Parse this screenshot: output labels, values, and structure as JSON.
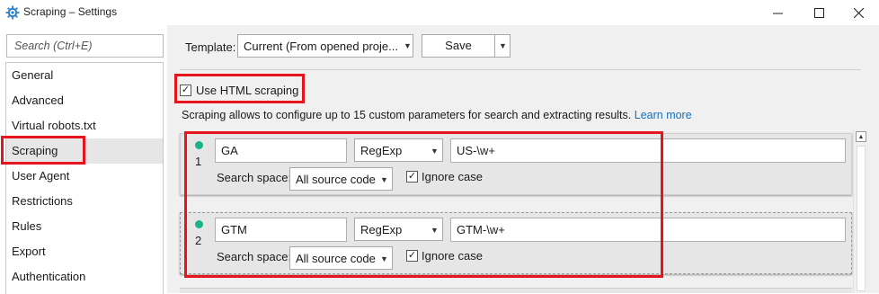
{
  "window": {
    "title": "Scraping – Settings",
    "icon": "gear-app-icon"
  },
  "sidebar": {
    "search_placeholder": "Search (Ctrl+E)",
    "items": [
      {
        "label": "General"
      },
      {
        "label": "Advanced"
      },
      {
        "label": "Virtual robots.txt"
      },
      {
        "label": "Scraping",
        "selected": true
      },
      {
        "label": "User Agent"
      },
      {
        "label": "Restrictions"
      },
      {
        "label": "Rules"
      },
      {
        "label": "Export"
      },
      {
        "label": "Authentication"
      }
    ]
  },
  "toolbar": {
    "template_label": "Template:",
    "template_value": "Current (From opened proje...",
    "save_label": "Save"
  },
  "scraping": {
    "use_html_label": "Use HTML scraping",
    "use_html_checked": true,
    "description": "Scraping allows to configure up to 15 custom parameters for search and extracting results.",
    "learn_more": "Learn more",
    "search_space_label": "Search space:",
    "ignore_case_label": "Ignore case",
    "params": [
      {
        "index": "1",
        "name": "GA",
        "method": "RegExp",
        "pattern": "US-\\w+",
        "search_space": "All source code",
        "ignore_case": true,
        "status_color": "#18b38a"
      },
      {
        "index": "2",
        "name": "GTM",
        "method": "RegExp",
        "pattern": "GTM-\\w+",
        "search_space": "All source code",
        "ignore_case": true,
        "status_color": "#18b38a"
      }
    ]
  },
  "colors": {
    "highlight": "#e8141c",
    "link": "#1a6fb5",
    "status_dot": "#18b38a"
  }
}
